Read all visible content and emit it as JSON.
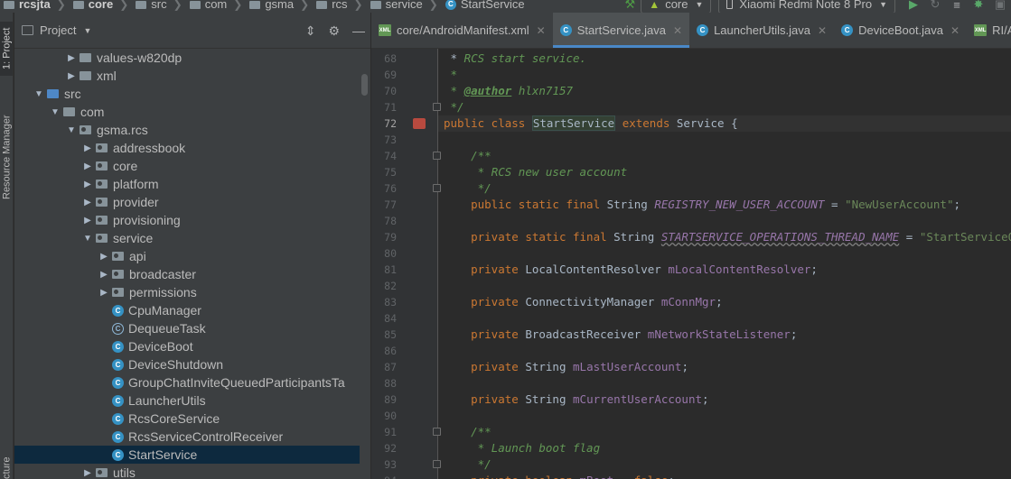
{
  "navbar": {
    "crumbs": [
      "rcsjta",
      "core",
      "src",
      "com",
      "gsma",
      "rcs",
      "service"
    ],
    "current_class": "StartService",
    "module": "core",
    "device": "Xiaomi Redmi Note 8 Pro"
  },
  "left_strip": {
    "tabs": [
      "1: Project",
      "Resource Manager",
      "cture"
    ]
  },
  "project_panel": {
    "title": "Project",
    "tree": [
      {
        "label": "values-w820dp",
        "depth": 4,
        "arrow": "right",
        "icon": "folder"
      },
      {
        "label": "xml",
        "depth": 4,
        "arrow": "right",
        "icon": "folder"
      },
      {
        "label": "src",
        "depth": 2,
        "arrow": "down",
        "icon": "folder-blue"
      },
      {
        "label": "com",
        "depth": 3,
        "arrow": "down",
        "icon": "folder"
      },
      {
        "label": "gsma.rcs",
        "depth": 4,
        "arrow": "down",
        "icon": "package"
      },
      {
        "label": "addressbook",
        "depth": 5,
        "arrow": "right",
        "icon": "package"
      },
      {
        "label": "core",
        "depth": 5,
        "arrow": "right",
        "icon": "package"
      },
      {
        "label": "platform",
        "depth": 5,
        "arrow": "right",
        "icon": "package"
      },
      {
        "label": "provider",
        "depth": 5,
        "arrow": "right",
        "icon": "package"
      },
      {
        "label": "provisioning",
        "depth": 5,
        "arrow": "right",
        "icon": "package"
      },
      {
        "label": "service",
        "depth": 5,
        "arrow": "down",
        "icon": "package"
      },
      {
        "label": "api",
        "depth": 6,
        "arrow": "right",
        "icon": "package"
      },
      {
        "label": "broadcaster",
        "depth": 6,
        "arrow": "right",
        "icon": "package"
      },
      {
        "label": "permissions",
        "depth": 6,
        "arrow": "right",
        "icon": "package"
      },
      {
        "label": "CpuManager",
        "depth": 6,
        "arrow": "none",
        "icon": "class"
      },
      {
        "label": "DequeueTask",
        "depth": 6,
        "arrow": "none",
        "icon": "abstract-class"
      },
      {
        "label": "DeviceBoot",
        "depth": 6,
        "arrow": "none",
        "icon": "class"
      },
      {
        "label": "DeviceShutdown",
        "depth": 6,
        "arrow": "none",
        "icon": "class"
      },
      {
        "label": "GroupChatInviteQueuedParticipantsTa",
        "depth": 6,
        "arrow": "none",
        "icon": "class"
      },
      {
        "label": "LauncherUtils",
        "depth": 6,
        "arrow": "none",
        "icon": "class"
      },
      {
        "label": "RcsCoreService",
        "depth": 6,
        "arrow": "none",
        "icon": "class"
      },
      {
        "label": "RcsServiceControlReceiver",
        "depth": 6,
        "arrow": "none",
        "icon": "class"
      },
      {
        "label": "StartService",
        "depth": 6,
        "arrow": "none",
        "icon": "class",
        "selected": true
      },
      {
        "label": "utils",
        "depth": 5,
        "arrow": "right",
        "icon": "package"
      }
    ]
  },
  "editor": {
    "tabs": [
      {
        "label": "core/AndroidManifest.xml",
        "icon": "xml",
        "active": false
      },
      {
        "label": "StartService.java",
        "icon": "class",
        "active": true
      },
      {
        "label": "LauncherUtils.java",
        "icon": "class",
        "active": false
      },
      {
        "label": "DeviceBoot.java",
        "icon": "class",
        "active": false
      },
      {
        "label": "RI/AndroidManif",
        "icon": "xml",
        "active": false
      }
    ],
    "current_line": 72,
    "lines": [
      {
        "n": 68,
        "html": " * <span class=\"cm\">RCS start service.</span>"
      },
      {
        "n": 69,
        "html": " <span class=\"cm\">*</span>"
      },
      {
        "n": 70,
        "html": " <span class=\"cm\">*</span> <span class=\"tag\">@author</span> <span class=\"cm\">hlxn7157</span>"
      },
      {
        "n": 71,
        "html": " <span class=\"cm\">*/</span>"
      },
      {
        "n": 72,
        "html": "<span class=\"kw\">public class</span> <span class=\"hl\">StartService</span> <span class=\"kw\">extends</span> Service {"
      },
      {
        "n": 73,
        "html": ""
      },
      {
        "n": 74,
        "html": "    <span class=\"cm\">/**</span>"
      },
      {
        "n": 75,
        "html": "     <span class=\"cm\">* RCS new user account</span>"
      },
      {
        "n": 76,
        "html": "     <span class=\"cm\">*/</span>"
      },
      {
        "n": 77,
        "html": "    <span class=\"kw\">public static final</span> String <span class=\"sfld\">REGISTRY_NEW_USER_ACCOUNT</span> = <span class=\"str\">\"NewUserAccount\"</span>;"
      },
      {
        "n": 78,
        "html": ""
      },
      {
        "n": 79,
        "html": "    <span class=\"kw\">private static final</span> String <span class=\"sfld warn\">STARTSERVICE_OPERATIONS_THREAD_NAME</span> = <span class=\"str\">\"StartServiceOps\"</span>;"
      },
      {
        "n": 80,
        "html": ""
      },
      {
        "n": 81,
        "html": "    <span class=\"kw\">private</span> LocalContentResolver <span class=\"fld\">mLocalContentResolver</span>;"
      },
      {
        "n": 82,
        "html": ""
      },
      {
        "n": 83,
        "html": "    <span class=\"kw\">private</span> ConnectivityManager <span class=\"fld\">mConnMgr</span>;"
      },
      {
        "n": 84,
        "html": ""
      },
      {
        "n": 85,
        "html": "    <span class=\"kw\">private</span> BroadcastReceiver <span class=\"fld\">mNetworkStateListener</span>;"
      },
      {
        "n": 86,
        "html": ""
      },
      {
        "n": 87,
        "html": "    <span class=\"kw\">private</span> String <span class=\"fld\">mLastUserAccount</span>;"
      },
      {
        "n": 88,
        "html": ""
      },
      {
        "n": 89,
        "html": "    <span class=\"kw\">private</span> String <span class=\"fld\">mCurrentUserAccount</span>;"
      },
      {
        "n": 90,
        "html": ""
      },
      {
        "n": 91,
        "html": "    <span class=\"cm\">/**</span>"
      },
      {
        "n": 92,
        "html": "     <span class=\"cm\">* Launch boot flag</span>"
      },
      {
        "n": 93,
        "html": "     <span class=\"cm\">*/</span>"
      },
      {
        "n": 94,
        "html": "    <span class=\"kw\">private boolean</span> <span class=\"fld\">mBoot</span> = <span class=\"kw\">false</span>;"
      }
    ]
  },
  "colors": {
    "background": "#2b2b2b",
    "panel": "#3c3f41",
    "selection": "#0d293e",
    "accent": "#4a88c7",
    "keyword": "#cc7832",
    "string": "#6a8759",
    "field": "#9876aa",
    "comment": "#629755"
  }
}
